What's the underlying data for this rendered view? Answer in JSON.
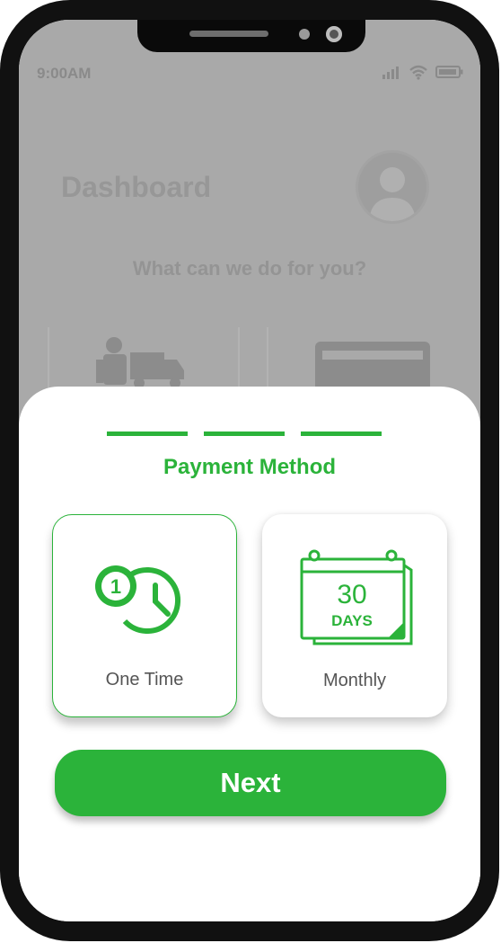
{
  "status_bar": {
    "time": "9:00AM",
    "icons": [
      "signal-icon",
      "wifi-icon",
      "battery-icon"
    ]
  },
  "dashboard": {
    "title": "Dashboard",
    "subtitle": "What can we do for you?"
  },
  "payment_sheet": {
    "step_count": 3,
    "title": "Payment Method",
    "options": [
      {
        "label": "One Time",
        "icon": "one-time-clock-icon",
        "selected": true
      },
      {
        "label": "Monthly",
        "icon": "calendar-30-days-icon",
        "selected": false,
        "icon_text_number": "30",
        "icon_text_unit": "DAYS"
      }
    ],
    "next_label": "Next"
  },
  "colors": {
    "accent": "#2bb33a",
    "overlay": "#a9a9a9",
    "frame": "#111111"
  }
}
